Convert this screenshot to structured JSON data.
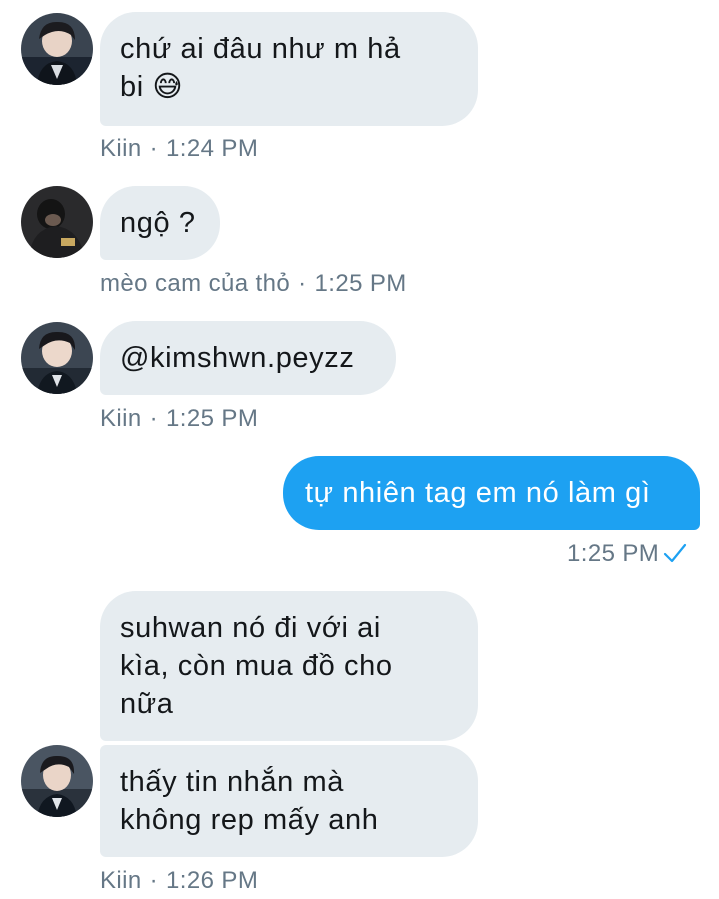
{
  "messages": [
    {
      "text": "chứ ai đâu như m hả bi 😅",
      "line1": "chứ ai đâu như m hả",
      "line2": "bi 😅",
      "sender": "Kiin",
      "time": "1:24 PM"
    },
    {
      "text": "ngộ ?",
      "sender": "mèo cam của thỏ",
      "time": "1:25 PM"
    },
    {
      "text": "@kimshwn.peyzz",
      "sender": "Kiin",
      "time": "1:25 PM"
    },
    {
      "text": "tự nhiên tag em nó làm gì",
      "time": "1:25 PM",
      "status_icon": "check-icon"
    },
    {
      "line1": "suhwan nó đi với ai",
      "line2": "kìa, còn mua đồ cho",
      "line3": "nữa"
    },
    {
      "line1": "thấy tin nhắn mà",
      "line2": "không rep mấy anh",
      "sender": "Kiin",
      "time": "1:26 PM"
    }
  ],
  "separator": "·",
  "colors": {
    "incoming_bubble": "#e6ecf0",
    "outgoing_bubble": "#1da1f2",
    "meta_text": "#657786",
    "check": "#1da1f2"
  }
}
